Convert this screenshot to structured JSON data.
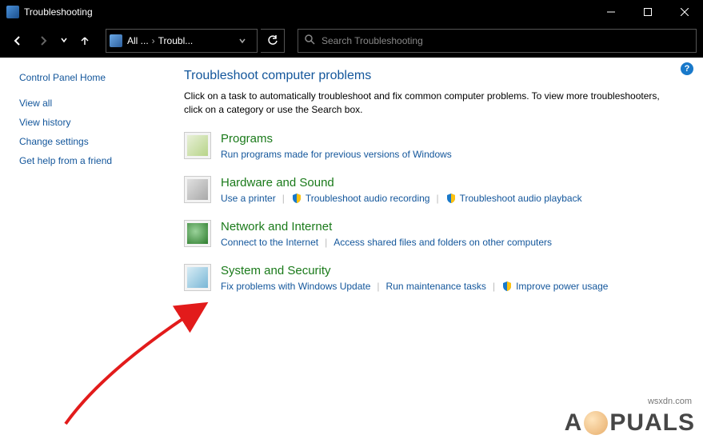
{
  "window": {
    "title": "Troubleshooting"
  },
  "addressbar": {
    "crumb1": "All ...",
    "crumb2": "Troubl..."
  },
  "search": {
    "placeholder": "Search Troubleshooting"
  },
  "sidebar": {
    "home": "Control Panel Home",
    "links": [
      "View all",
      "View history",
      "Change settings",
      "Get help from a friend"
    ]
  },
  "main": {
    "title": "Troubleshoot computer problems",
    "description": "Click on a task to automatically troubleshoot and fix common computer problems. To view more troubleshooters, click on a category or use the Search box."
  },
  "categories": {
    "programs": {
      "title": "Programs",
      "links": [
        "Run programs made for previous versions of Windows"
      ]
    },
    "hardware": {
      "title": "Hardware and Sound",
      "links": [
        "Use a printer",
        "Troubleshoot audio recording",
        "Troubleshoot audio playback"
      ]
    },
    "network": {
      "title": "Network and Internet",
      "links": [
        "Connect to the Internet",
        "Access shared files and folders on other computers"
      ]
    },
    "system": {
      "title": "System and Security",
      "links": [
        "Fix problems with Windows Update",
        "Run maintenance tasks",
        "Improve power usage"
      ]
    }
  },
  "watermark": {
    "text_left": "A",
    "text_right": "PUALS",
    "url": "wsxdn.com"
  }
}
